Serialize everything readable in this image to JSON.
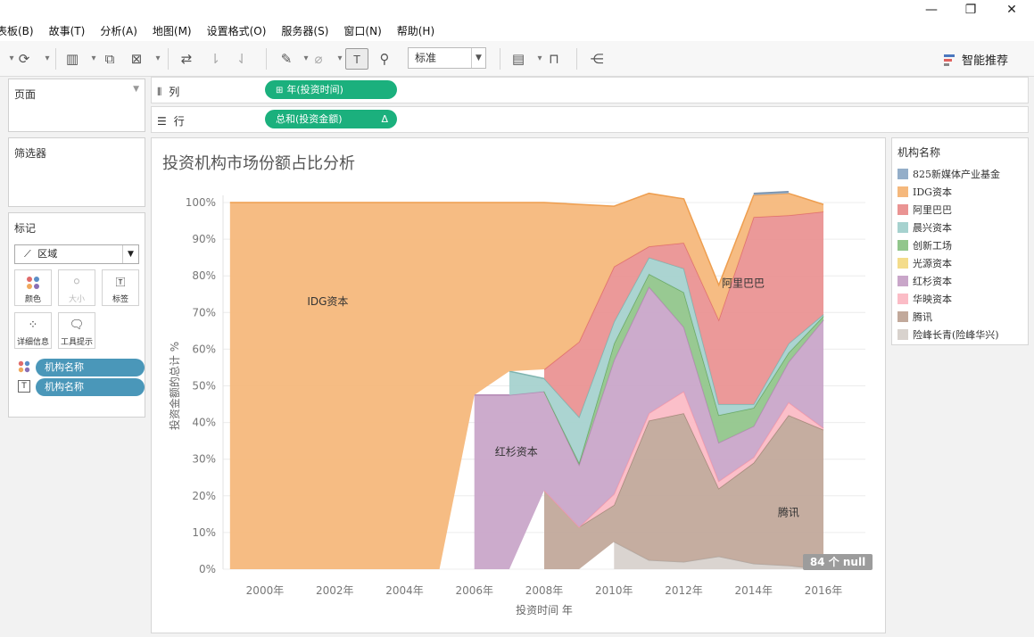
{
  "window": {
    "minimize_glyph": "—",
    "restore_glyph": "❐",
    "close_glyph": "✕"
  },
  "menu": [
    "表板(B)",
    "故事(T)",
    "分析(A)",
    "地图(M)",
    "设置格式(O)",
    "服务器(S)",
    "窗口(N)",
    "帮助(H)"
  ],
  "toolbar": {
    "fit_select": "标准",
    "smart_recommend": "智能推荐"
  },
  "panels": {
    "pages": "页面",
    "filters": "筛选器",
    "marks": "标记"
  },
  "marks": {
    "type": "区域",
    "buttons": {
      "color": "颜色",
      "size": "大小",
      "label": "标签",
      "detail": "详细信息",
      "tooltip": "工具提示"
    },
    "pills": [
      "机构名称",
      "机构名称"
    ]
  },
  "shelves": {
    "columns_label": "列",
    "columns_pill": "年(投资时间)",
    "rows_label": "行",
    "rows_pill": "总和(投资金额)",
    "rows_pill_delta": "Δ"
  },
  "viz": {
    "title": "投资机构市场份额占比分析",
    "null_badge": "84 个 null"
  },
  "legend": {
    "title": "机构名称",
    "items": [
      {
        "label": "825新媒体产业基金",
        "color": "#94aec9"
      },
      {
        "label": "IDG资本",
        "color": "#f5b87c"
      },
      {
        "label": "阿里巴巴",
        "color": "#ea9493"
      },
      {
        "label": "晨兴资本",
        "color": "#a6d2cf"
      },
      {
        "label": "创新工场",
        "color": "#92c68c"
      },
      {
        "label": "光源资本",
        "color": "#f4dc8b"
      },
      {
        "label": "红杉资本",
        "color": "#c9a6c9"
      },
      {
        "label": "华映资本",
        "color": "#fbbcc6"
      },
      {
        "label": "腾讯",
        "color": "#c2a99b"
      },
      {
        "label": "险峰长青(险峰华兴)",
        "color": "#d8d2cd"
      }
    ]
  },
  "chart_data": {
    "type": "area",
    "title": "投资机构市场份额占比分析",
    "xlabel": "投资时间 年",
    "ylabel": "投资金额的总计 %",
    "x_ticks": [
      "2000年",
      "2002年",
      "2004年",
      "2006年",
      "2008年",
      "2010年",
      "2012年",
      "2014年",
      "2016年"
    ],
    "y_ticks": [
      "100%",
      "90%",
      "80%",
      "70%",
      "60%",
      "50%",
      "40%",
      "30%",
      "20%",
      "10%",
      "0%"
    ],
    "ylim": [
      0,
      100
    ],
    "xlim": [
      1998.8,
      2017.2
    ],
    "stacked_percent": true,
    "grid": "horizontal",
    "labels": [
      "IDG资本",
      "红杉资本",
      "阿里巴巴",
      "腾讯"
    ],
    "series": [
      {
        "name": "险峰长青(险峰华兴)",
        "color": "#d8d2cd",
        "outline": "#b3aaa4",
        "x": [
          2010,
          2011,
          2012,
          2013,
          2014,
          2015,
          2016
        ],
        "y": [
          7.5,
          2.5,
          2,
          3.5,
          1.5,
          1,
          0
        ]
      },
      {
        "name": "腾讯",
        "color": "#c2a99b",
        "outline": "#a58b7c",
        "x": [
          2008,
          2009,
          2010,
          2011,
          2012,
          2013,
          2014,
          2015,
          2016
        ],
        "y": [
          21.5,
          11.5,
          10,
          38,
          40.5,
          18.5,
          27.5,
          41,
          38
        ]
      },
      {
        "name": "华映资本",
        "color": "#fbbcc6",
        "outline": "#f59aaa",
        "x": [
          2008,
          2009,
          2010,
          2011,
          2012,
          2013,
          2014,
          2015,
          2016
        ],
        "y": [
          0,
          0,
          3,
          2,
          6,
          2,
          1.5,
          3.5,
          0.5
        ]
      },
      {
        "name": "红杉资本",
        "color": "#c9a6c9",
        "outline": "#b389b3",
        "x": [
          2006,
          2007,
          2008,
          2009,
          2010,
          2011,
          2012,
          2013,
          2014,
          2015,
          2016
        ],
        "y": [
          47.5,
          47.5,
          27,
          17,
          36.5,
          34.5,
          17.5,
          10.5,
          8.5,
          11,
          29.5
        ]
      },
      {
        "name": "创新工场",
        "color": "#92c68c",
        "outline": "#6aa964",
        "x": [
          2008,
          2009,
          2010,
          2011,
          2012,
          2013,
          2014,
          2015,
          2016
        ],
        "y": [
          0,
          0.5,
          4.5,
          3.5,
          9.5,
          7.5,
          5,
          2.5,
          1
        ]
      },
      {
        "name": "晨兴资本",
        "color": "#a6d2cf",
        "outline": "#7fb4b0",
        "x": [
          2007,
          2008,
          2009,
          2010,
          2011,
          2012,
          2013,
          2014,
          2015,
          2016
        ],
        "y": [
          6.5,
          3.5,
          12.5,
          6,
          4.5,
          6.5,
          3,
          1,
          2.5,
          0.5
        ]
      },
      {
        "name": "阿里巴巴",
        "color": "#ea9493",
        "outline": "#df6f6f",
        "x": [
          2008,
          2009,
          2010,
          2011,
          2012,
          2013,
          2014,
          2015,
          2016
        ],
        "y": [
          2.5,
          20.5,
          15,
          3,
          7,
          23,
          51,
          35,
          28
        ]
      },
      {
        "name": "IDG资本",
        "color": "#f5b87c",
        "outline": "#ee9e4f",
        "x": [
          1999,
          2005,
          2006,
          2007,
          2008,
          2009,
          2010,
          2011,
          2012,
          2013,
          2014,
          2015,
          2016
        ],
        "y": [
          100,
          100,
          52.5,
          46,
          45.5,
          37.5,
          16.5,
          14.5,
          12,
          9.5,
          6,
          6,
          2
        ]
      },
      {
        "name": "825新媒体产业基金",
        "color": "#94aec9",
        "outline": "#7890aa",
        "x": [
          2014,
          2015
        ],
        "y": [
          0.5,
          0.5
        ]
      }
    ]
  }
}
